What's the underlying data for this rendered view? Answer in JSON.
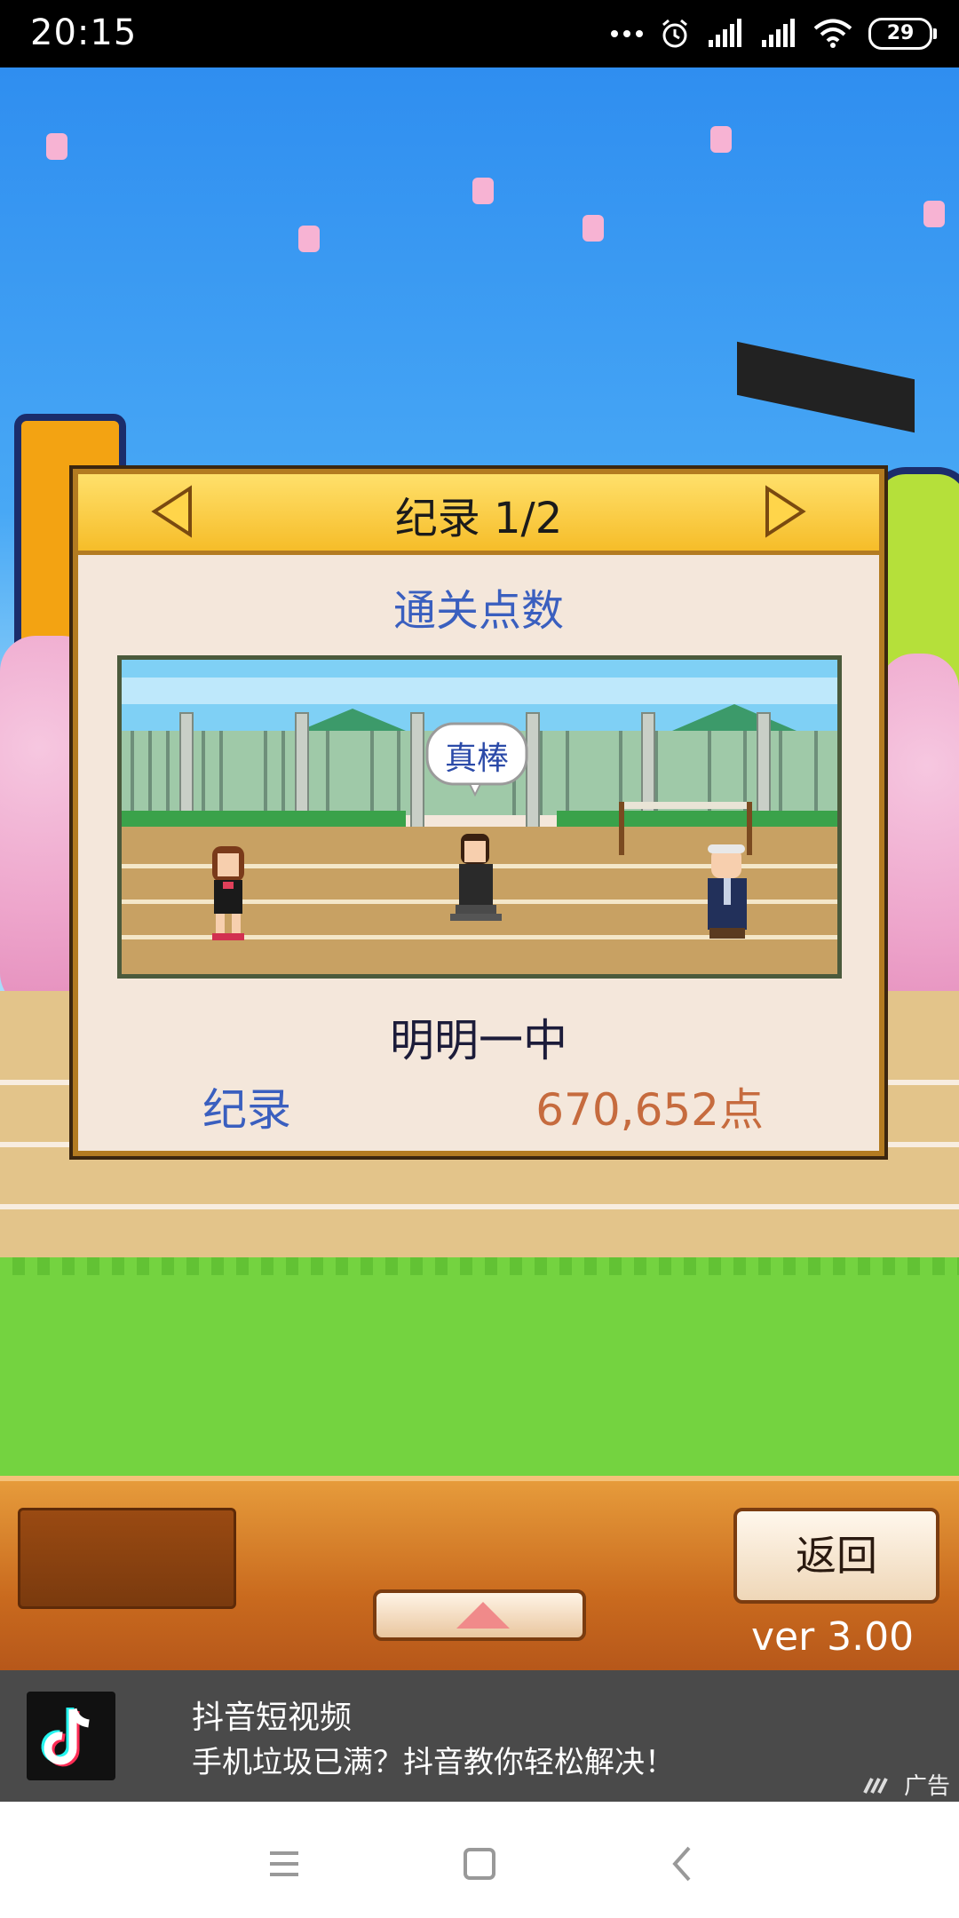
{
  "status_bar": {
    "time": "20:15",
    "battery": "29",
    "icons": [
      "more-dots-icon",
      "alarm-icon",
      "signal-icon",
      "signal-icon",
      "wifi-icon",
      "battery-icon"
    ]
  },
  "dialog": {
    "title": "纪录 1/2",
    "subtitle": "通关点数",
    "speech_bubble": "真棒",
    "school_name": "明明一中",
    "record_label": "纪录",
    "record_value": "670,652点"
  },
  "controls": {
    "back_label": "返回",
    "version": "ver 3.00"
  },
  "ad": {
    "app_name": "抖音短视频",
    "description": "手机垃圾已满？抖音教你轻松解决！",
    "tag": "广告"
  },
  "colors": {
    "dialog_header": "#f6bd29",
    "dialog_body": "#f4e7db",
    "label_blue": "#3a5fbf",
    "value_orange": "#c66b3e"
  }
}
